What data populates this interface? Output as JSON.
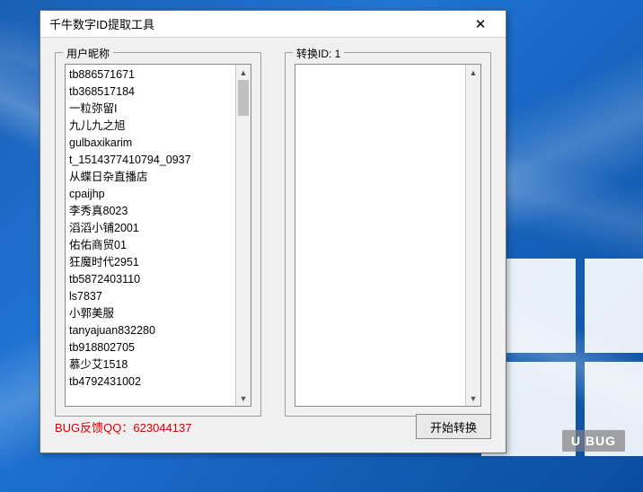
{
  "window": {
    "title": "千牛数字ID提取工具"
  },
  "left_group": {
    "legend": "用户昵称"
  },
  "right_group": {
    "legend": "转换ID: 1"
  },
  "usernames": [
    "tb886571671",
    "tb368517184",
    "一粒弥留I",
    "九儿九之旭",
    "gulbaxikarim",
    "t_1514377410794_0937",
    "从蝶日杂直播店",
    "cpaijhp",
    "李秀真8023",
    "滔滔小铺2001",
    "佑佑商贸01",
    "狂魔时代2951",
    "tb5872403110",
    "ls7837",
    "小郭美服",
    "tanyajuan832280",
    "tb918802705",
    "慕少艾1518",
    "tb4792431002"
  ],
  "footer": {
    "bug_text": "BUG反馈QQ：623044137",
    "start_label": "开始转换"
  },
  "watermark": "U BUG"
}
